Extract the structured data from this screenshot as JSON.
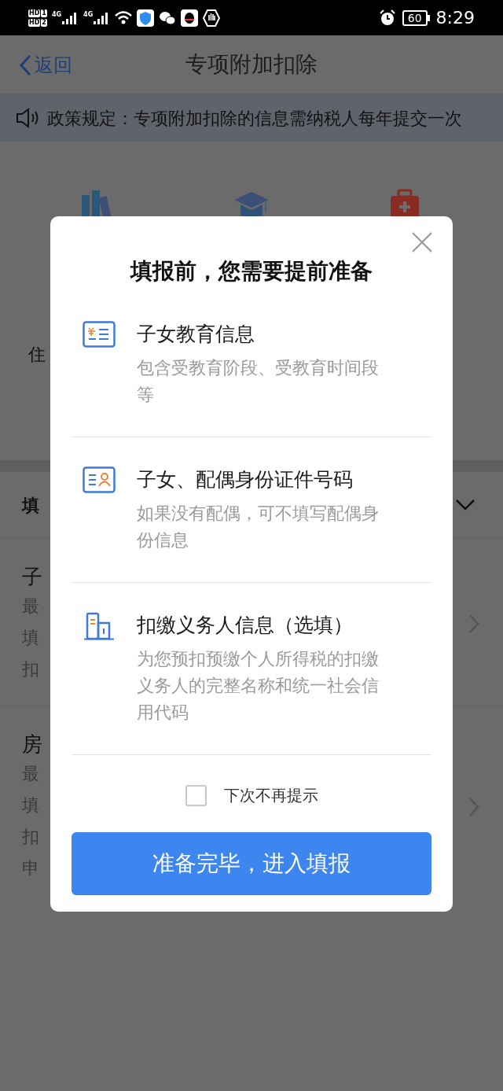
{
  "status_bar": {
    "sims": [
      {
        "label": "HD",
        "slot": "1"
      },
      {
        "label": "HD",
        "slot": "2"
      }
    ],
    "networks": [
      "4G",
      "4G"
    ],
    "battery": "60",
    "time": "8:29"
  },
  "nav": {
    "back": "返回",
    "title": "专项附加扣除"
  },
  "notice": {
    "text": "政策规定：专项附加扣除的信息需纳税人每年提交一次"
  },
  "categories": {
    "label_fragment": "住"
  },
  "section": {
    "title_fragment": "填"
  },
  "records": [
    {
      "title": "子",
      "lines": [
        "最",
        "填",
        "扣"
      ]
    },
    {
      "title": "房",
      "lines": [
        "最",
        "填",
        "扣",
        "申"
      ]
    }
  ],
  "dialog": {
    "title": "填报前，您需要提前准备",
    "items": [
      {
        "kind": "student-card",
        "title": "子女教育信息",
        "description": "包含受教育阶段、受教育时间段等"
      },
      {
        "kind": "id-card",
        "title": "子女、配偶身份证件号码",
        "description": "如果没有配偶，可不填写配偶身份信息"
      },
      {
        "kind": "building",
        "title": "扣缴义务人信息（选填）",
        "description": "为您预扣预缴个人所得税的扣缴义务人的完整名称和统一社会信用代码"
      }
    ],
    "dont_remind": {
      "label": "下次不再提示",
      "checked": false
    },
    "confirm": "准备完毕，进入填报"
  }
}
